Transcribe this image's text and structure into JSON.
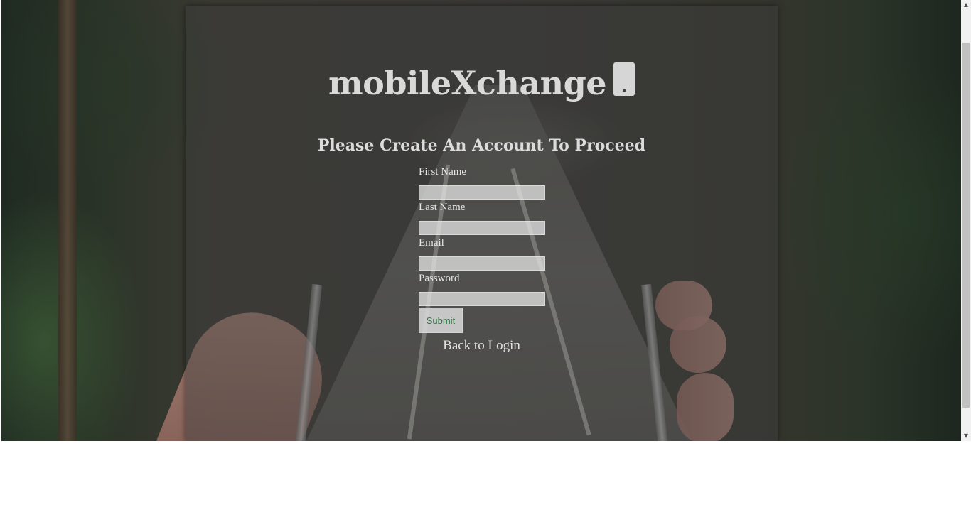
{
  "app": {
    "brand_title": "mobileXchange",
    "brand_icon": "mobile-phone-icon"
  },
  "page": {
    "heading": "Please Create An Account To Proceed"
  },
  "form": {
    "first_name_label": "First Name",
    "first_name_value": "",
    "last_name_label": "Last Name",
    "last_name_value": "",
    "email_label": "Email",
    "email_value": "",
    "password_label": "Password",
    "password_value": "",
    "submit_label": "Submit"
  },
  "links": {
    "back_to_login": "Back to Login"
  },
  "colors": {
    "card_overlay": "#3c3c3c",
    "submit_text": "#2e7a45",
    "text_light": "#e0e0e0"
  }
}
